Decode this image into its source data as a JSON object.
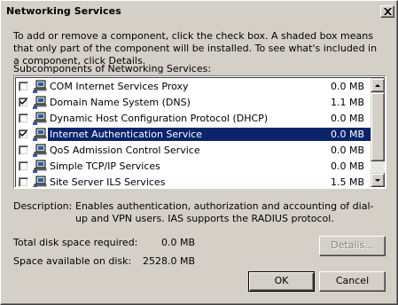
{
  "window": {
    "title": "Networking Services"
  },
  "intro_text": "To add or remove a component, click the check box. A shaded box means that only part of the component will be installed. To see what's included in a component, click Details.",
  "list_label": "Subcomponents of Networking Services:",
  "components": [
    {
      "label": "COM Internet Services Proxy",
      "size": "0.0 MB",
      "checked": false,
      "selected": false,
      "icon": "network-icon"
    },
    {
      "label": "Domain Name System (DNS)",
      "size": "1.1 MB",
      "checked": true,
      "selected": false,
      "icon": "network-icon"
    },
    {
      "label": "Dynamic Host Configuration Protocol (DHCP)",
      "size": "0.0 MB",
      "checked": false,
      "selected": false,
      "icon": "network-icon"
    },
    {
      "label": "Internet Authentication Service",
      "size": "0.0 MB",
      "checked": true,
      "selected": true,
      "icon": "network-icon"
    },
    {
      "label": "QoS Admission Control Service",
      "size": "0.0 MB",
      "checked": false,
      "selected": false,
      "icon": "network-icon"
    },
    {
      "label": "Simple TCP/IP Services",
      "size": "0.0 MB",
      "checked": false,
      "selected": false,
      "icon": "network-icon"
    },
    {
      "label": "Site Server ILS Services",
      "size": "1.5 MB",
      "checked": false,
      "selected": false,
      "icon": "network-icon"
    }
  ],
  "description": {
    "label": "Description:",
    "text": "Enables authentication, authorization and accounting of dial-up and VPN users. IAS supports the RADIUS protocol."
  },
  "space": {
    "required_label": "Total disk space required:",
    "required_value": "0.0 MB",
    "available_label": "Space available on disk:",
    "available_value": "2528.0 MB"
  },
  "buttons": {
    "details": "Details...",
    "ok": "OK",
    "cancel": "Cancel"
  },
  "colors": {
    "face": "#d4d0c8",
    "selection": "#0a246a"
  }
}
